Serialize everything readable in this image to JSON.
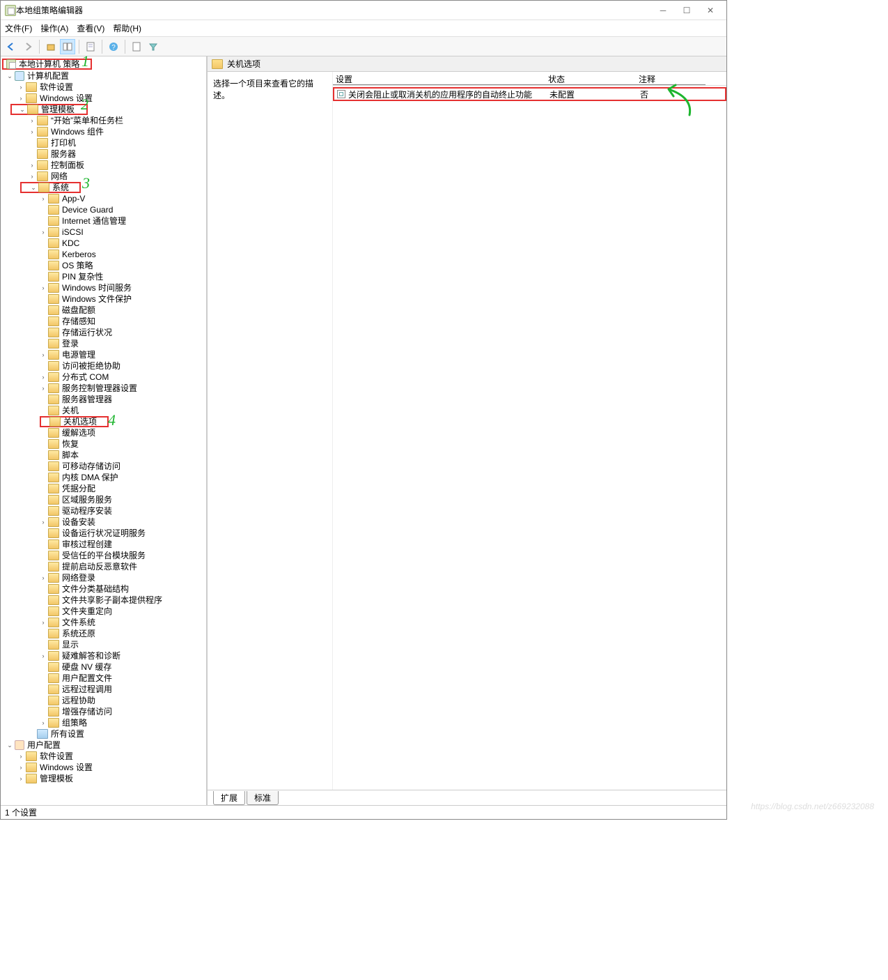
{
  "title": "本地组策略编辑器",
  "menu": {
    "file": "文件(F)",
    "action": "操作(A)",
    "view": "查看(V)",
    "help": "帮助(H)"
  },
  "tree": {
    "root": "本地计算机 策略",
    "computerConfig": "计算机配置",
    "softwareSettings": "软件设置",
    "windowsSettings": "Windows 设置",
    "adminTemplates": "管理模板",
    "startMenu": "“开始”菜单和任务栏",
    "winComponents": "Windows 组件",
    "printer": "打印机",
    "server": "服务器",
    "controlPanel": "控制面板",
    "network": "网络",
    "system": "系统",
    "sys": {
      "appv": "App-V",
      "deviceGuard": "Device Guard",
      "internetComm": "Internet 通信管理",
      "iscsi": "iSCSI",
      "kdc": "KDC",
      "kerberos": "Kerberos",
      "osPolicy": "OS 策略",
      "pinComplexity": "PIN 复杂性",
      "winTime": "Windows 时间服务",
      "winFileProtect": "Windows 文件保护",
      "diskQuota": "磁盘配额",
      "storageSense": "存储感知",
      "storageHealth": "存储运行状况",
      "logon": "登录",
      "powerMgmt": "电源管理",
      "deniedAccess": "访问被拒绝协助",
      "distCOM": "分布式 COM",
      "scmSettings": "服务控制管理器设置",
      "serverMgr": "服务器管理器",
      "shutdown": "关机",
      "shutdownOptions": "关机选项",
      "bufferOptions": "缓解选项",
      "recovery": "恢复",
      "scripts": "脚本",
      "removableStorage": "可移动存储访问",
      "kernelDMA": "内核 DMA 保护",
      "credAssign": "凭据分配",
      "regionalServices": "区域服务服务",
      "driverInstall": "驱动程序安装",
      "deviceInstall": "设备安装",
      "deviceRunHealth": "设备运行状况证明服务",
      "auditProcCreate": "审核过程创建",
      "trustedPlatform": "受信任的平台模块服务",
      "earlyLaunch": "提前启动反恶意软件",
      "netLogon": "网络登录",
      "fileClassBasic": "文件分类基础结构",
      "fileShareShadow": "文件共享影子副本提供程序",
      "folderRedir": "文件夹重定向",
      "fileSystem": "文件系统",
      "systemRestore": "系统还原",
      "display": "显示",
      "troubleshoot": "疑难解答和诊断",
      "diskNVCache": "硬盘 NV 缓存",
      "userProfile": "用户配置文件",
      "remoteProc": "远程过程调用",
      "remoteAssist": "远程协助",
      "enhancedStorage": "增强存储访问",
      "groupPolicy": "组策略"
    },
    "allSettings": "所有设置",
    "userConfig": "用户配置",
    "uSoftware": "软件设置",
    "uWindows": "Windows 设置",
    "uAdmin": "管理模板"
  },
  "content": {
    "headerTitle": "关机选项",
    "descLabel": "选择一个项目来查看它的描述。",
    "columns": {
      "setting": "设置",
      "status": "状态",
      "note": "注释"
    },
    "row1": {
      "setting": "关闭会阻止或取消关机的应用程序的自动终止功能",
      "status": "未配置",
      "note": "否"
    },
    "tabs": {
      "extended": "扩展",
      "standard": "标准"
    }
  },
  "statusbar": "1 个设置",
  "annotations": {
    "n1": "1",
    "n2": "2",
    "n3": "3",
    "n4": "4"
  },
  "watermark": "https://blog.csdn.net/z669232088"
}
